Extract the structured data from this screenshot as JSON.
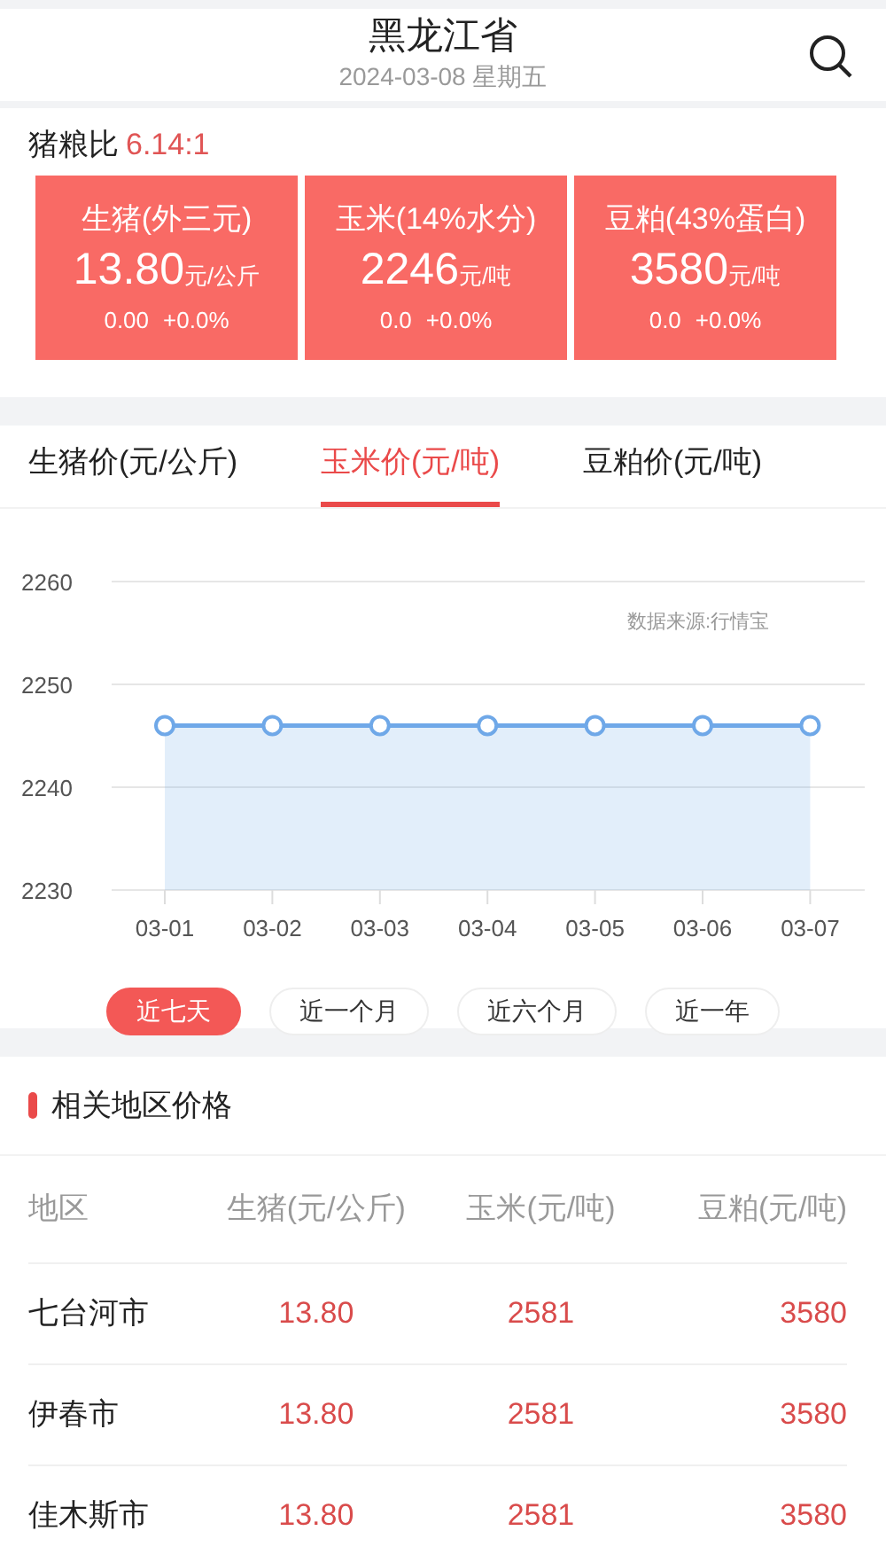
{
  "header": {
    "title": "黑龙江省",
    "date": "2024-03-08 星期五"
  },
  "ratio": {
    "label": "猪粮比",
    "value": "6.14:1"
  },
  "price_cards": [
    {
      "name": "生猪(外三元)",
      "price": "13.80",
      "unit": "元/公斤",
      "change": "0.00",
      "percent": "+0.0%"
    },
    {
      "name": "玉米(14%水分)",
      "price": "2246",
      "unit": "元/吨",
      "change": "0.0",
      "percent": "+0.0%"
    },
    {
      "name": "豆粕(43%蛋白)",
      "price": "3580",
      "unit": "元/吨",
      "change": "0.0",
      "percent": "+0.0%"
    }
  ],
  "tabs": [
    {
      "label": "生猪价(元/公斤)",
      "selected": false
    },
    {
      "label": "玉米价(元/吨)",
      "selected": true
    },
    {
      "label": "豆粕价(元/吨)",
      "selected": false
    }
  ],
  "chart": {
    "source": "数据来源:行情宝",
    "chart_data": {
      "type": "area",
      "categories": [
        "03-01",
        "03-02",
        "03-03",
        "03-04",
        "03-05",
        "03-06",
        "03-07"
      ],
      "series": [
        {
          "color": "#6fa8e8",
          "values": [
            2246,
            2246,
            2246,
            2246,
            2246,
            2246,
            2246
          ]
        }
      ],
      "ylim": [
        2230,
        2260
      ],
      "yticks": [
        2230,
        2240,
        2250,
        2260
      ]
    }
  },
  "ranges": [
    {
      "label": "近七天",
      "selected": true
    },
    {
      "label": "近一个月",
      "selected": false
    },
    {
      "label": "近六个月",
      "selected": false
    },
    {
      "label": "近一年",
      "selected": false
    }
  ],
  "regions": {
    "title": "相关地区价格",
    "columns": [
      "地区",
      "生猪(元/公斤)",
      "玉米(元/吨)",
      "豆粕(元/吨)"
    ],
    "rows": [
      [
        "七台河市",
        "13.80",
        "2581",
        "3580"
      ],
      [
        "伊春市",
        "13.80",
        "2581",
        "3580"
      ],
      [
        "佳木斯市",
        "13.80",
        "2581",
        "3580"
      ]
    ]
  }
}
